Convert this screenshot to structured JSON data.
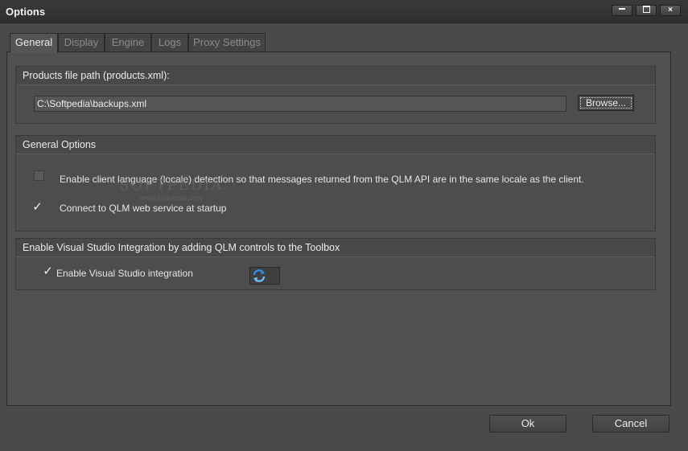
{
  "window": {
    "title": "Options",
    "controls": {
      "minimize": "minimize",
      "maximize": "maximize",
      "close": "×"
    }
  },
  "tabs": [
    {
      "label": "General",
      "active": true
    },
    {
      "label": "Display",
      "active": false
    },
    {
      "label": "Engine",
      "active": false
    },
    {
      "label": "Logs",
      "active": false
    },
    {
      "label": "Proxy Settings",
      "active": false
    }
  ],
  "products": {
    "header": "Products file path (products.xml):",
    "path_value": "C:\\Softpedia\\backups.xml",
    "browse_label": "Browse..."
  },
  "general_options": {
    "header": "General Options",
    "client_language": {
      "label": "Enable client language (locale) detection so that messages returned from the QLM API are in the same locale as the client.",
      "checked": false
    },
    "connect_startup": {
      "label": "Connect to QLM web service at startup",
      "checked": true
    }
  },
  "visual_studio": {
    "header": "Enable Visual Studio Integration by adding QLM controls to the Toolbox",
    "enable": {
      "label": "Enable Visual Studio integration",
      "checked": true
    },
    "refresh_icon": "refresh-icon"
  },
  "watermark": {
    "text": "SOFTPEDIA",
    "sub": "www.softpedia.com"
  },
  "footer": {
    "ok_label": "Ok",
    "cancel_label": "Cancel"
  },
  "colors": {
    "background": "#4a4a4a",
    "panel": "#505050",
    "refresh_blue": "#2f8fe6"
  }
}
